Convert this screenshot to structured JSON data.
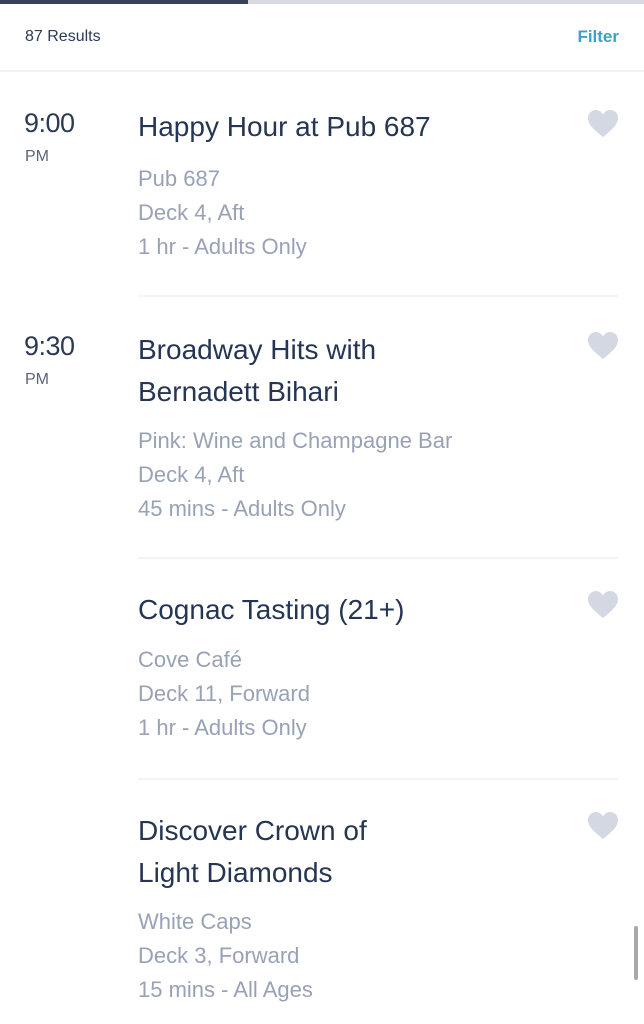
{
  "tab_indicator": {
    "active_fraction": 0.385,
    "active_color": "#37435a"
  },
  "header": {
    "results_count": "87 Results",
    "filter_label": "Filter"
  },
  "colors": {
    "accent": "#3ba3c4",
    "title": "#253553",
    "detail": "#98a1b5",
    "heart": "#d3d8e2"
  },
  "events": [
    {
      "time": "9:00",
      "ampm": "PM",
      "title_lines": [
        "Happy Hour at Pub 687"
      ],
      "venue": "Pub 687",
      "location": "Deck 4, Aft",
      "duration": "1 hr - Adults Only",
      "favorite_icon": "heart-icon",
      "favorited": false
    },
    {
      "time": "9:30",
      "ampm": "PM",
      "title_lines": [
        "Broadway Hits with",
        "Bernadett Bihari"
      ],
      "venue": "Pink: Wine and Champagne Bar",
      "location": "Deck 4, Aft",
      "duration": "45 mins - Adults Only",
      "favorite_icon": "heart-icon",
      "favorited": false
    },
    {
      "time": "",
      "ampm": "",
      "title_lines": [
        "Cognac Tasting (21+)"
      ],
      "venue": "Cove Café",
      "location": "Deck 11, Forward",
      "duration": "1 hr - Adults Only",
      "favorite_icon": "heart-icon",
      "favorited": false
    },
    {
      "time": "",
      "ampm": "",
      "title_lines": [
        "Discover Crown of",
        "Light Diamonds"
      ],
      "venue": "White Caps",
      "location": "Deck 3, Forward",
      "duration": "15 mins - All Ages",
      "favorite_icon": "heart-icon",
      "favorited": false
    }
  ]
}
